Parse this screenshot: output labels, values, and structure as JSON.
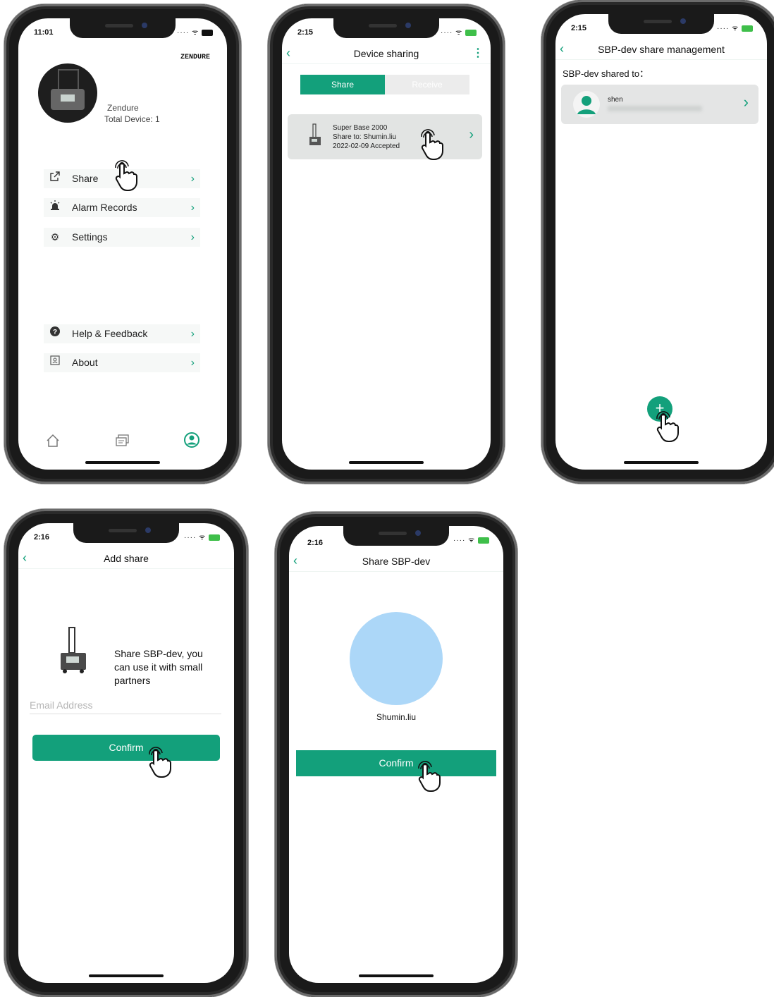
{
  "screens": {
    "profile": {
      "time": "11:01",
      "logo": "ZENDURE",
      "user_name": "Zendure",
      "total_device": "Total Device: 1",
      "menu": [
        {
          "label": "Share",
          "icon": "share-icon"
        },
        {
          "label": "Alarm Records",
          "icon": "alarm-icon"
        },
        {
          "label": "Settings",
          "icon": "gear-icon"
        },
        {
          "label": "Help & Feedback",
          "icon": "help-icon"
        },
        {
          "label": "About",
          "icon": "about-icon"
        }
      ],
      "tabbar": [
        "home-icon",
        "messages-icon",
        "profile-icon"
      ]
    },
    "device_sharing": {
      "time": "2:15",
      "title": "Device sharing",
      "tabs": [
        "Share",
        "Receive"
      ],
      "active_tab": "Share",
      "item": {
        "device": "Super Base 2000",
        "share_to": "Share to: Shumin.liu",
        "status": "2022-02-09 Accepted"
      }
    },
    "share_management": {
      "time": "2:15",
      "title": "SBP-dev share management",
      "subtitle": "SBP-dev shared to：",
      "user": {
        "name": "shen"
      }
    },
    "add_share": {
      "time": "2:16",
      "title": "Add share",
      "message": "Share SBP-dev, you can use it with small partners",
      "email_placeholder": "Email Address",
      "confirm": "Confirm"
    },
    "share_device": {
      "time": "2:16",
      "title": "Share SBP-dev",
      "user_name": "Shumin.liu",
      "confirm": "Confirm"
    }
  },
  "colors": {
    "accent": "#13a07b",
    "avatar_circle": "#acd7f8"
  }
}
